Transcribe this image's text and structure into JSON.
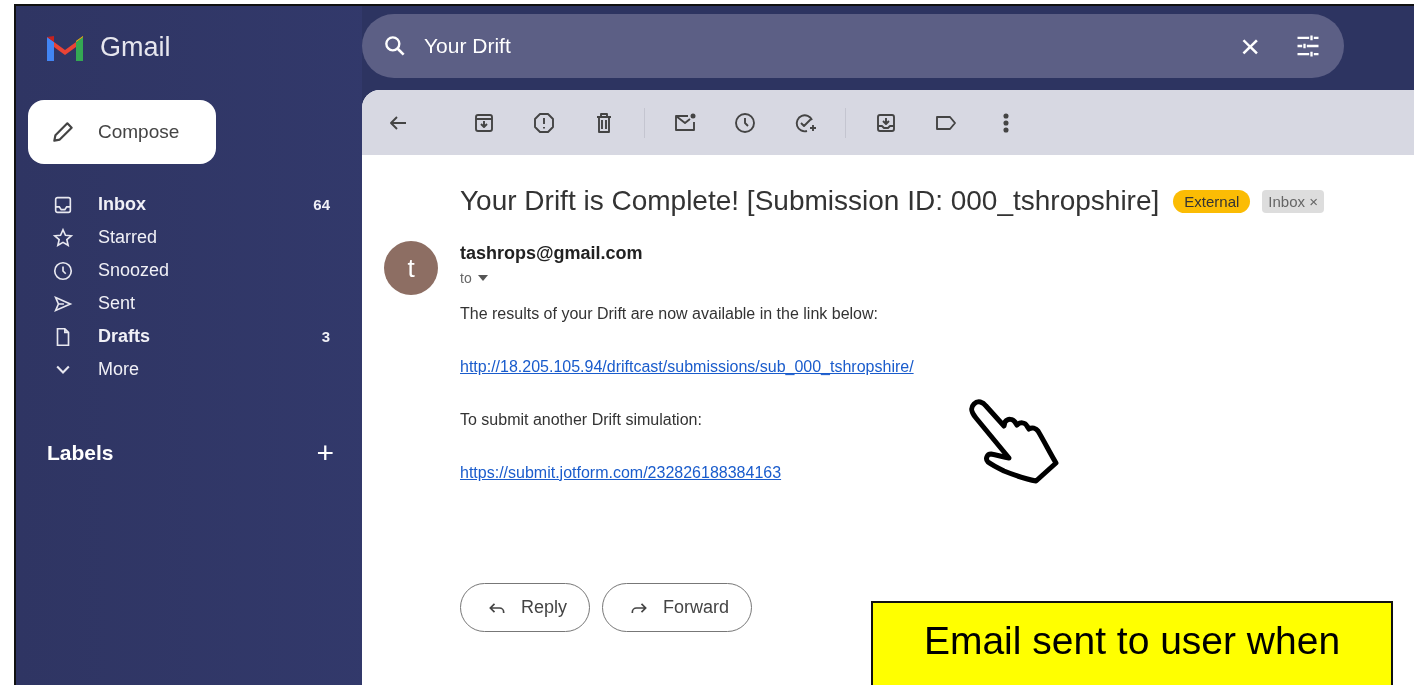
{
  "app": {
    "name": "Gmail"
  },
  "search": {
    "value": "Your Drift",
    "clear": "×"
  },
  "compose": {
    "label": "Compose"
  },
  "nav": [
    {
      "label": "Inbox",
      "count": "64",
      "unread": true
    },
    {
      "label": "Starred",
      "unread": false
    },
    {
      "label": "Snoozed",
      "unread": false
    },
    {
      "label": "Sent",
      "unread": false
    },
    {
      "label": "Drafts",
      "count": "3",
      "unread": true
    },
    {
      "label": "More",
      "unread": false
    }
  ],
  "labels": {
    "title": "Labels",
    "add": "+"
  },
  "email": {
    "subject": "Your Drift is Complete! [Submission ID: 000_tshropshire]",
    "tags": [
      {
        "kind": "external",
        "label": "External",
        "color": "#fbbc04"
      },
      {
        "kind": "folder",
        "label": "Inbox",
        "remove": "×"
      }
    ],
    "sender": "tashrops@gmail.com",
    "avatar": "t",
    "recipient": "to",
    "body": [
      {
        "kind": "text",
        "text": "The results of your Drift are now available in the link below:"
      },
      {
        "kind": "link",
        "text": "http://18.205.105.94/driftcast/submissions/sub_000_tshropshire/"
      },
      {
        "kind": "text",
        "text": "To submit another Drift simulation:"
      },
      {
        "kind": "link",
        "text": "https://submit.jotform.com/232826188384163"
      }
    ],
    "actions": [
      {
        "kind": "reply",
        "label": "Reply"
      },
      {
        "kind": "forward",
        "label": "Forward"
      }
    ]
  },
  "annotation": {
    "text": "Email sent to user when"
  }
}
